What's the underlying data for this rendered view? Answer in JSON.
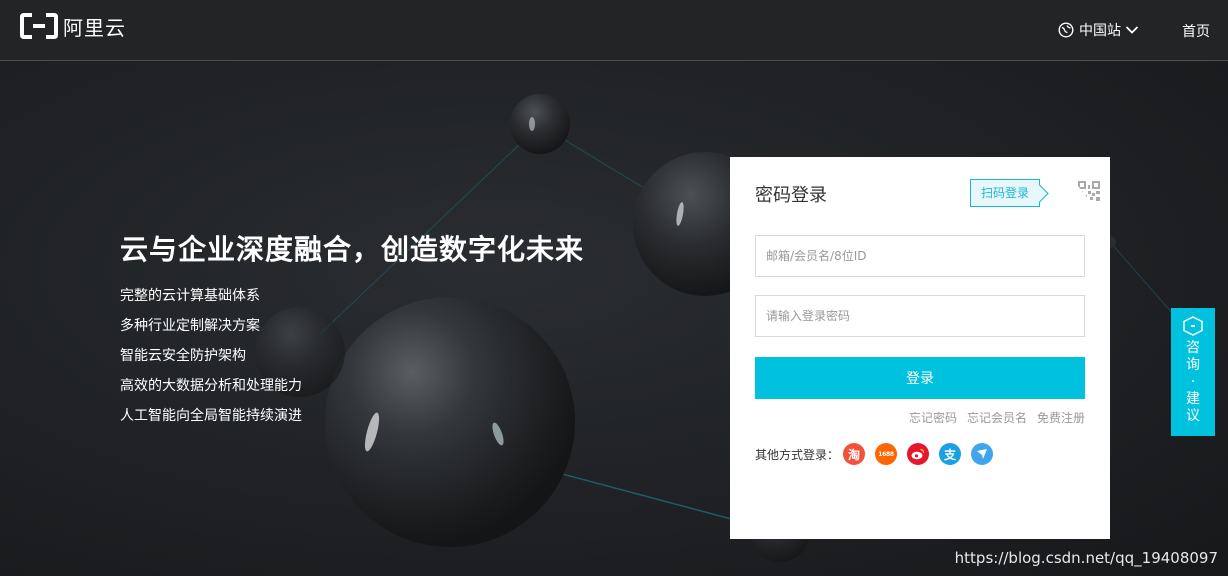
{
  "header": {
    "logo_text": "阿里云",
    "site_switch_label": "中国站",
    "home_label": "首页"
  },
  "hero": {
    "slogan": "云与企业深度融合，创造数字化未来",
    "features": [
      "完整的云计算基础体系",
      "多种行业定制解决方案",
      "智能云安全防护架构",
      "高效的大数据分析和处理能力",
      "人工智能向全局智能持续演进"
    ]
  },
  "login": {
    "title": "密码登录",
    "qr_tip": "扫码登录",
    "username_placeholder": "邮箱/会员名/8位ID",
    "password_placeholder": "请输入登录密码",
    "submit_label": "登录",
    "links": {
      "forgot_password": "忘记密码",
      "forgot_username": "忘记会员名",
      "register": "免费注册"
    },
    "other_login_label": "其他方式登录：",
    "other_login_icons": [
      {
        "name": "taobao-icon",
        "glyph": "淘",
        "color": "#f4513c"
      },
      {
        "name": "1688-icon",
        "glyph": "1688",
        "color": "#ff6600"
      },
      {
        "name": "weibo-icon",
        "glyph": "weibo",
        "color": "#e6162d"
      },
      {
        "name": "alipay-icon",
        "glyph": "支",
        "color": "#1ba0e1"
      },
      {
        "name": "aliwangwang-icon",
        "glyph": "bird",
        "color": "#41a5ee"
      }
    ]
  },
  "consult": {
    "label": "咨询·建议"
  },
  "watermark": "https://blog.csdn.net/qq_19408097",
  "colors": {
    "accent": "#00c1de",
    "header_bg": "#222426",
    "page_bg": "#1f2124"
  }
}
